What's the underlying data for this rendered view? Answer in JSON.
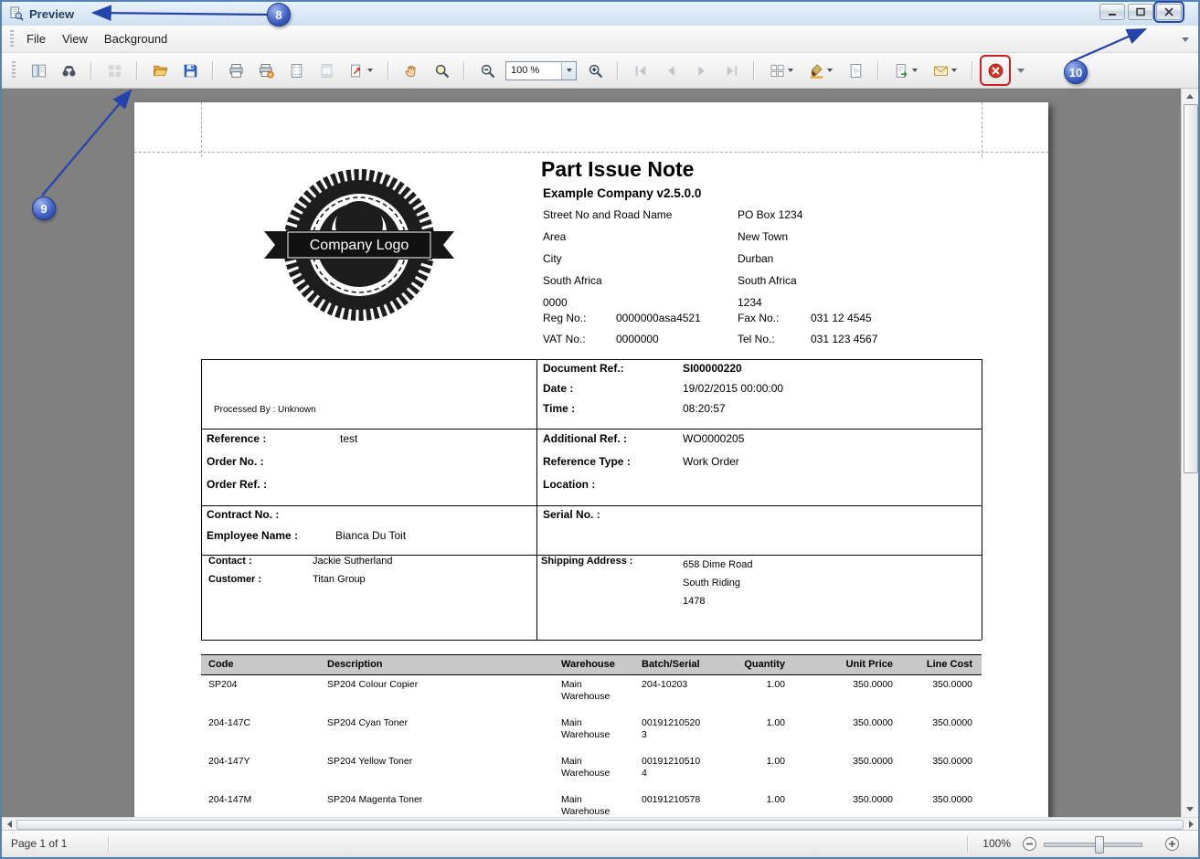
{
  "window": {
    "title": "Preview"
  },
  "menu": {
    "items": [
      "File",
      "View",
      "Background"
    ]
  },
  "toolbar": {
    "zoom_value": "100 %"
  },
  "annotations": {
    "n8": "8",
    "n9": "9",
    "n10": "10"
  },
  "statusbar": {
    "page_info": "Page 1 of 1",
    "zoom_percent": "100%"
  },
  "document": {
    "title": "Part Issue Note",
    "company_name": "Example Company v2.5.0.0",
    "logo_text": "Company Logo",
    "address_left": [
      "Street No and Road Name",
      "Area",
      "City",
      "South Africa",
      "0000"
    ],
    "address_right": [
      "PO Box 1234",
      "New Town",
      "Durban",
      "South Africa",
      "1234"
    ],
    "reg": {
      "label": "Reg No.:",
      "value": "0000000asa4521"
    },
    "vat": {
      "label": "VAT No.:",
      "value": "0000000"
    },
    "fax": {
      "label": "Fax No.:",
      "value": "031 12 4545"
    },
    "tel": {
      "label": "Tel No.:",
      "value": "031 123 4567"
    },
    "doc_ref": {
      "label": "Document Ref.:",
      "value": "SI00000220"
    },
    "date": {
      "label": "Date :",
      "value": "19/02/2015 00:00:00"
    },
    "time": {
      "label": "Time :",
      "value": "08:20:57"
    },
    "processed_by": "Processed By : Unknown",
    "reference": {
      "label": "Reference :",
      "value": "test"
    },
    "order_no": {
      "label": "Order No. :",
      "value": ""
    },
    "order_ref": {
      "label": "Order Ref. :",
      "value": ""
    },
    "additional_ref": {
      "label": "Additional Ref. :",
      "value": "WO0000205"
    },
    "reference_type": {
      "label": "Reference Type :",
      "value": "Work Order"
    },
    "location": {
      "label": "Location :",
      "value": ""
    },
    "contract_no": {
      "label": "Contract No. :",
      "value": ""
    },
    "serial_no": {
      "label": "Serial No. :",
      "value": ""
    },
    "employee": {
      "label": "Employee Name :",
      "value": "Bianca Du Toit"
    },
    "contact": {
      "label": "Contact :",
      "value": "Jackie Sutherland"
    },
    "customer": {
      "label": "Customer :",
      "value": "Titan Group"
    },
    "shipping": {
      "label": "Shipping Address :",
      "lines": [
        "658 Dime Road",
        "South Riding",
        "1478"
      ]
    },
    "table": {
      "headers": [
        "Code",
        "Description",
        "Warehouse",
        "Batch/Serial",
        "Quantity",
        "Unit Price",
        "Line Cost"
      ],
      "rows": [
        [
          "SP204",
          "SP204 Colour Copier",
          "Main Warehouse",
          "204-10203",
          "1.00",
          "350.0000",
          "350.0000"
        ],
        [
          "204-147C",
          "SP204 Cyan Toner",
          "Main Warehouse",
          "001912105203",
          "1.00",
          "350.0000",
          "350.0000"
        ],
        [
          "204-147Y",
          "SP204 Yellow Toner",
          "Main Warehouse",
          "001912105104",
          "1.00",
          "350.0000",
          "350.0000"
        ],
        [
          "204-147M",
          "SP204 Magenta Toner",
          "Main Warehouse",
          "00191210578",
          "1.00",
          "350.0000",
          "350.0000"
        ]
      ]
    }
  }
}
